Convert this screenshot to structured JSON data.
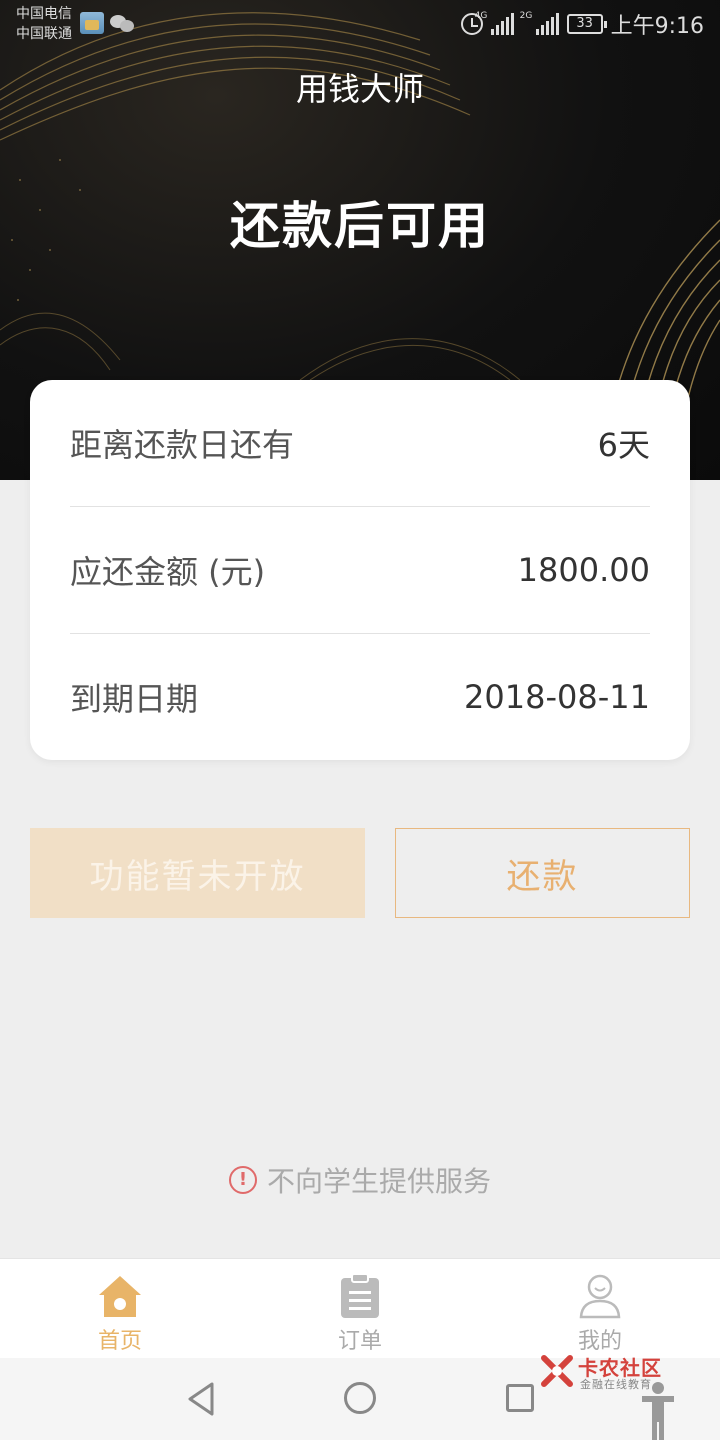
{
  "status_bar": {
    "carrier_1": "中国电信",
    "carrier_2": "中国联通",
    "net_1": "4G",
    "net_2": "2G",
    "battery": "33",
    "time": "上午9:16"
  },
  "header": {
    "title": "用钱大师",
    "status_text": "还款后可用"
  },
  "loan_card": {
    "rows": [
      {
        "label": "距离还款日还有",
        "value": "6天"
      },
      {
        "label": "应还金额 (元)",
        "value": "1800.00"
      },
      {
        "label": "到期日期",
        "value": "2018-08-11"
      }
    ]
  },
  "actions": {
    "disabled_label": "功能暂未开放",
    "repay_label": "还款"
  },
  "notice": {
    "icon": "!",
    "text": "不向学生提供服务"
  },
  "tabbar": {
    "items": [
      {
        "label": "首页",
        "icon": "home-icon",
        "active": true
      },
      {
        "label": "订单",
        "icon": "clipboard-icon",
        "active": false
      },
      {
        "label": "我的",
        "icon": "user-icon",
        "active": false
      }
    ]
  },
  "watermark": {
    "brand": "卡农社区",
    "sub": "金融在线教育"
  },
  "colors": {
    "accent": "#e8b468",
    "disabled_bg": "#f1dfc6",
    "danger": "#e06a6a"
  }
}
